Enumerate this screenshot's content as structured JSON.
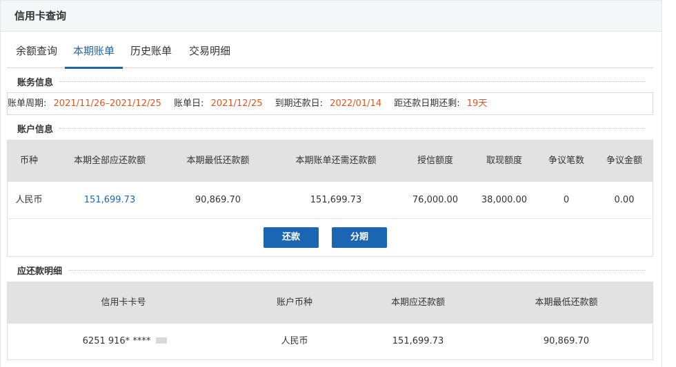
{
  "header": {
    "title": "信用卡查询"
  },
  "tabs": [
    {
      "label": "余额查询"
    },
    {
      "label": "本期账单"
    },
    {
      "label": "历史账单"
    },
    {
      "label": "交易明细"
    }
  ],
  "billing_info": {
    "section_title": "账务信息",
    "period_label": "账单周期:",
    "period_value": "2021/11/26–2021/12/25",
    "bill_date_label": "账单日:",
    "bill_date_value": "2021/12/25",
    "due_date_label": "到期还款日:",
    "due_date_value": "2022/01/14",
    "remaining_label": "距还款日期还剩:",
    "remaining_value": "19天"
  },
  "account_info": {
    "section_title": "账户信息",
    "columns": [
      "币种",
      "本期全部应还款额",
      "本期最低还款额",
      "本期账单还需还款额",
      "授信额度",
      "取现额度",
      "争议笔数",
      "争议金额"
    ],
    "row": {
      "currency": "人民币",
      "total_due": "151,699.73",
      "min_due": "90,869.70",
      "remaining_due": "151,699.73",
      "credit_limit": "76,000.00",
      "cash_limit": "38,000.00",
      "dispute_count": "0",
      "dispute_amount": "0.00"
    },
    "repay_button": "还款",
    "installment_button": "分期"
  },
  "repayment_detail": {
    "section_title": "应还款明细",
    "columns": [
      "信用卡卡号",
      "账户币种",
      "本期应还款额",
      "本期最低还款额"
    ],
    "row": {
      "card_number": "6251 916* ****",
      "currency": "人民币",
      "due_amount": "151,699.73",
      "min_amount": "90,869.70"
    }
  }
}
